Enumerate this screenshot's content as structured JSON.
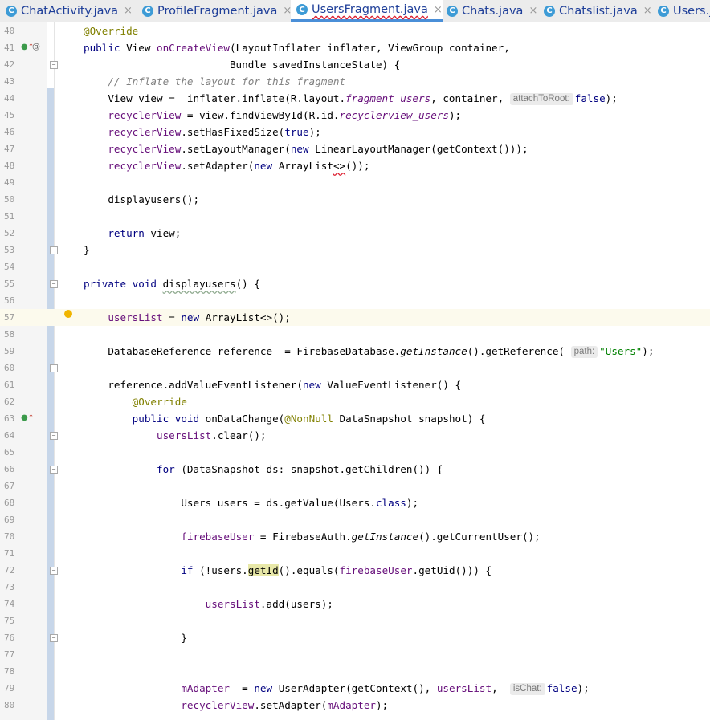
{
  "tabs": [
    {
      "label": "ChatActivity.java",
      "icon": "C",
      "active": false,
      "close": "×"
    },
    {
      "label": "ProfileFragment.java",
      "icon": "C",
      "active": false,
      "close": "×"
    },
    {
      "label": "UsersFragment.java",
      "icon": "C",
      "active": true,
      "close": "×"
    },
    {
      "label": "Chats.java",
      "icon": "C",
      "active": false,
      "close": "×"
    },
    {
      "label": "Chatslist.java",
      "icon": "C",
      "active": false,
      "close": "×"
    },
    {
      "label": "Users.ja",
      "icon": "C",
      "active": false,
      "close": ""
    }
  ],
  "current_line": 57,
  "gutter_icons": [
    {
      "line": 41,
      "icons": [
        "override-arrow-icon",
        "annotation-at-icon"
      ]
    },
    {
      "line": 57,
      "icons": [
        "intention-bulb-icon"
      ]
    },
    {
      "line": 63,
      "icons": [
        "override-arrow-icon"
      ]
    }
  ],
  "fold_markers": [
    42,
    53,
    55,
    60,
    64,
    66,
    72,
    76
  ],
  "lines": [
    {
      "n": "40",
      "t": [
        [
          "@Override",
          "an"
        ]
      ]
    },
    {
      "n": "41",
      "t": [
        [
          "public ",
          "kw"
        ],
        [
          "View ",
          ""
        ],
        [
          "onCreateView",
          "fd"
        ],
        [
          "(LayoutInflater inflater, ViewGroup container,",
          ""
        ]
      ]
    },
    {
      "n": "42",
      "t": [
        [
          "                        Bundle savedInstanceState) {",
          ""
        ]
      ]
    },
    {
      "n": "43",
      "t": [
        [
          "    // Inflate the layout for this fragment",
          "cm"
        ]
      ]
    },
    {
      "n": "44",
      "t": [
        [
          "    View view =  inflater.inflate(R.layout.",
          ""
        ],
        [
          "fragment_users",
          "fi"
        ],
        [
          ", container, ",
          ""
        ],
        [
          "attachToRoot:",
          "hint"
        ],
        [
          "false",
          "kw"
        ],
        [
          ");",
          ""
        ]
      ]
    },
    {
      "n": "45",
      "t": [
        [
          "    ",
          ""
        ],
        [
          "recyclerView",
          "fd"
        ],
        [
          " = view.findViewById(R.id.",
          ""
        ],
        [
          "recyclerview_users",
          "fi"
        ],
        [
          ");",
          ""
        ]
      ]
    },
    {
      "n": "46",
      "t": [
        [
          "    ",
          ""
        ],
        [
          "recyclerView",
          "fd"
        ],
        [
          ".setHasFixedSize(",
          ""
        ],
        [
          "true",
          "kw"
        ],
        [
          ");",
          ""
        ]
      ]
    },
    {
      "n": "47",
      "t": [
        [
          "    ",
          ""
        ],
        [
          "recyclerView",
          "fd"
        ],
        [
          ".setLayoutManager(",
          ""
        ],
        [
          "new ",
          "kw"
        ],
        [
          "LinearLayoutManager(getContext()));",
          ""
        ]
      ]
    },
    {
      "n": "48",
      "t": [
        [
          "    ",
          ""
        ],
        [
          "recyclerView",
          "fd"
        ],
        [
          ".setAdapter(",
          ""
        ],
        [
          "new ",
          "kw"
        ],
        [
          "ArrayList",
          ""
        ],
        [
          "<>",
          "wavy"
        ],
        [
          "());",
          ""
        ]
      ]
    },
    {
      "n": "49",
      "t": []
    },
    {
      "n": "50",
      "t": [
        [
          "    displayusers();",
          ""
        ]
      ]
    },
    {
      "n": "51",
      "t": []
    },
    {
      "n": "52",
      "t": [
        [
          "    ",
          ""
        ],
        [
          "return ",
          "kw"
        ],
        [
          "view;",
          ""
        ]
      ]
    },
    {
      "n": "53",
      "t": [
        [
          "}",
          ""
        ]
      ]
    },
    {
      "n": "54",
      "t": []
    },
    {
      "n": "55",
      "t": [
        [
          "private void ",
          "kw"
        ],
        [
          "displayusers",
          "wavy-g"
        ],
        [
          "() {",
          ""
        ]
      ]
    },
    {
      "n": "56",
      "t": []
    },
    {
      "n": "57",
      "t": [
        [
          "    ",
          ""
        ],
        [
          "usersList",
          "fd"
        ],
        [
          " = ",
          ""
        ],
        [
          "new ",
          "kw"
        ],
        [
          "ArrayList<>();",
          ""
        ]
      ]
    },
    {
      "n": "58",
      "t": []
    },
    {
      "n": "59",
      "t": [
        [
          "    DatabaseReference reference  = FirebaseDatabase.",
          ""
        ],
        [
          "getInstance",
          "it"
        ],
        [
          "().getReference( ",
          ""
        ],
        [
          "path:",
          "hint"
        ],
        [
          "\"Users\"",
          "st"
        ],
        [
          ");",
          ""
        ]
      ]
    },
    {
      "n": "60",
      "t": []
    },
    {
      "n": "61",
      "t": [
        [
          "    reference.addValueEventListener(",
          ""
        ],
        [
          "new ",
          "kw"
        ],
        [
          "ValueEventListener() {",
          ""
        ]
      ]
    },
    {
      "n": "62",
      "t": [
        [
          "        ",
          ""
        ],
        [
          "@Override",
          "an"
        ]
      ]
    },
    {
      "n": "63",
      "t": [
        [
          "        ",
          ""
        ],
        [
          "public void ",
          "kw"
        ],
        [
          "onDataChange(",
          ""
        ],
        [
          "@NonNull ",
          "an"
        ],
        [
          "DataSnapshot snapshot) {",
          ""
        ]
      ]
    },
    {
      "n": "64",
      "t": [
        [
          "            ",
          ""
        ],
        [
          "usersList",
          "fd"
        ],
        [
          ".clear();",
          ""
        ]
      ]
    },
    {
      "n": "65",
      "t": []
    },
    {
      "n": "66",
      "t": [
        [
          "            ",
          ""
        ],
        [
          "for ",
          "kw"
        ],
        [
          "(DataSnapshot ds: snapshot.getChildren()) {",
          ""
        ]
      ]
    },
    {
      "n": "67",
      "t": []
    },
    {
      "n": "68",
      "t": [
        [
          "                Users users = ds.getValue(Users.",
          ""
        ],
        [
          "class",
          "kw"
        ],
        [
          ");",
          ""
        ]
      ]
    },
    {
      "n": "69",
      "t": []
    },
    {
      "n": "70",
      "t": [
        [
          "                ",
          ""
        ],
        [
          "firebaseUser",
          "fd"
        ],
        [
          " = FirebaseAuth.",
          ""
        ],
        [
          "getInstance",
          "it"
        ],
        [
          "().getCurrentUser();",
          ""
        ]
      ]
    },
    {
      "n": "71",
      "t": []
    },
    {
      "n": "72",
      "t": [
        [
          "                ",
          ""
        ],
        [
          "if ",
          "kw"
        ],
        [
          "(!users.",
          ""
        ],
        [
          "getId",
          "hl"
        ],
        [
          "().equals(",
          ""
        ],
        [
          "firebaseUser",
          "fd"
        ],
        [
          ".getUid())) {",
          ""
        ]
      ]
    },
    {
      "n": "73",
      "t": []
    },
    {
      "n": "74",
      "t": [
        [
          "                    ",
          ""
        ],
        [
          "usersList",
          "fd"
        ],
        [
          ".add(users);",
          ""
        ]
      ]
    },
    {
      "n": "75",
      "t": []
    },
    {
      "n": "76",
      "t": [
        [
          "                }",
          ""
        ]
      ]
    },
    {
      "n": "77",
      "t": []
    },
    {
      "n": "78",
      "t": []
    },
    {
      "n": "79",
      "t": [
        [
          "                ",
          ""
        ],
        [
          "mAdapter",
          "fd"
        ],
        [
          "  = ",
          ""
        ],
        [
          "new ",
          "kw"
        ],
        [
          "UserAdapter(getContext(), ",
          ""
        ],
        [
          "usersList",
          "fd"
        ],
        [
          ",  ",
          ""
        ],
        [
          "isChat:",
          "hint"
        ],
        [
          "false",
          "kw"
        ],
        [
          ");",
          ""
        ]
      ]
    },
    {
      "n": "80",
      "t": [
        [
          "                ",
          ""
        ],
        [
          "recyclerView",
          "fd"
        ],
        [
          ".setAdapter(",
          ""
        ],
        [
          "mAdapter",
          "fd"
        ],
        [
          ");",
          ""
        ]
      ]
    }
  ]
}
